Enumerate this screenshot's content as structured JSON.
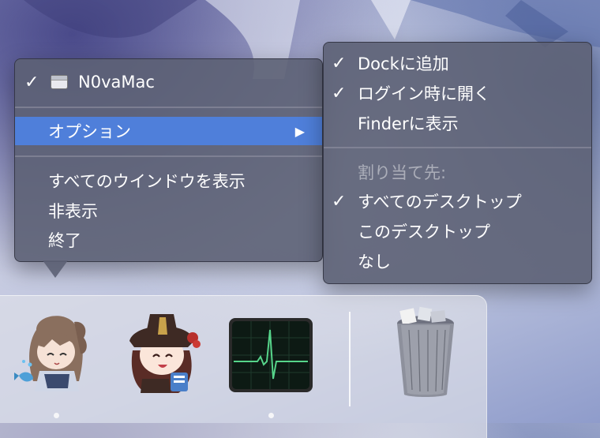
{
  "context_menu": {
    "app_item": {
      "check": "✓",
      "label": "N0vaMac"
    },
    "options_item": {
      "label": "オプション",
      "arrow": "▶"
    },
    "show_all_windows": "すべてのウインドウを表示",
    "hide": "非表示",
    "quit": "終了"
  },
  "submenu": {
    "keep_in_dock": {
      "check": "✓",
      "label": "Dockに追加"
    },
    "open_at_login": {
      "check": "✓",
      "label": "ログイン時に開く"
    },
    "show_in_finder": {
      "label": "Finderに表示"
    },
    "assign_to_header": "割り当て先:",
    "all_desktops": {
      "check": "✓",
      "label": "すべてのデスクトップ"
    },
    "this_desktop": {
      "label": "このデスクトップ"
    },
    "none": {
      "label": "なし"
    }
  },
  "dock": {
    "items": [
      {
        "icon": "anime-girl-with-fish-icon",
        "running": true
      },
      {
        "icon": "anime-girl-with-hat-icon",
        "running": false
      },
      {
        "icon": "activity-monitor-icon",
        "running": true
      },
      {
        "icon": "trash-full-icon",
        "running": false
      }
    ]
  },
  "colors": {
    "menu_bg": "#5c6074",
    "highlight": "#4f7fda",
    "monitor_line": "#56d48a"
  }
}
